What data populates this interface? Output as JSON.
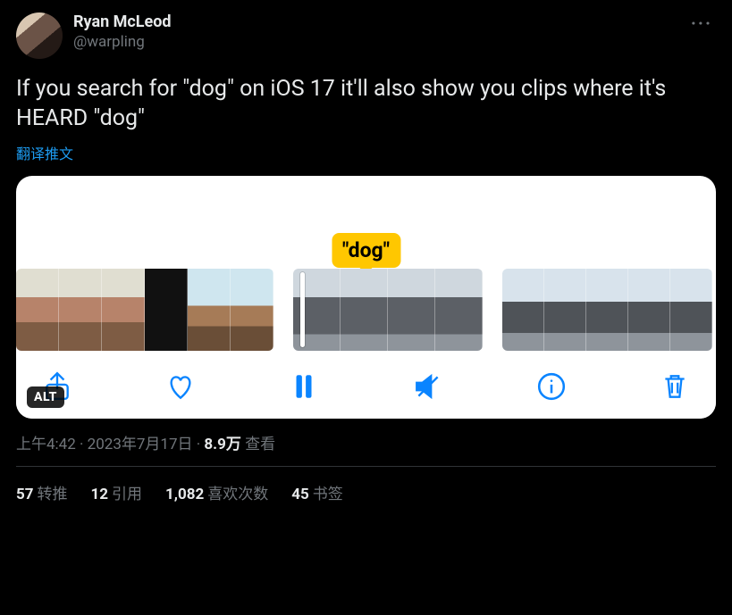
{
  "author": {
    "display_name": "Ryan McLeod",
    "handle": "@warpling"
  },
  "body_text": "If you search for \"dog\" on iOS 17 it'll also show you clips where it's HEARD \"dog\"",
  "translate_label": "翻译推文",
  "tooltip_text": "\"dog\"",
  "alt_badge": "ALT",
  "meta": {
    "time": "上午4:42",
    "date": "2023年7月17日",
    "dot": " · ",
    "views_number": "8.9万",
    "views_label": " 查看"
  },
  "stats": {
    "retweets": {
      "count": "57",
      "label": "转推"
    },
    "quotes": {
      "count": "12",
      "label": "引用"
    },
    "likes": {
      "count": "1,082",
      "label": "喜欢次数"
    },
    "bookmarks": {
      "count": "45",
      "label": "书签"
    }
  }
}
